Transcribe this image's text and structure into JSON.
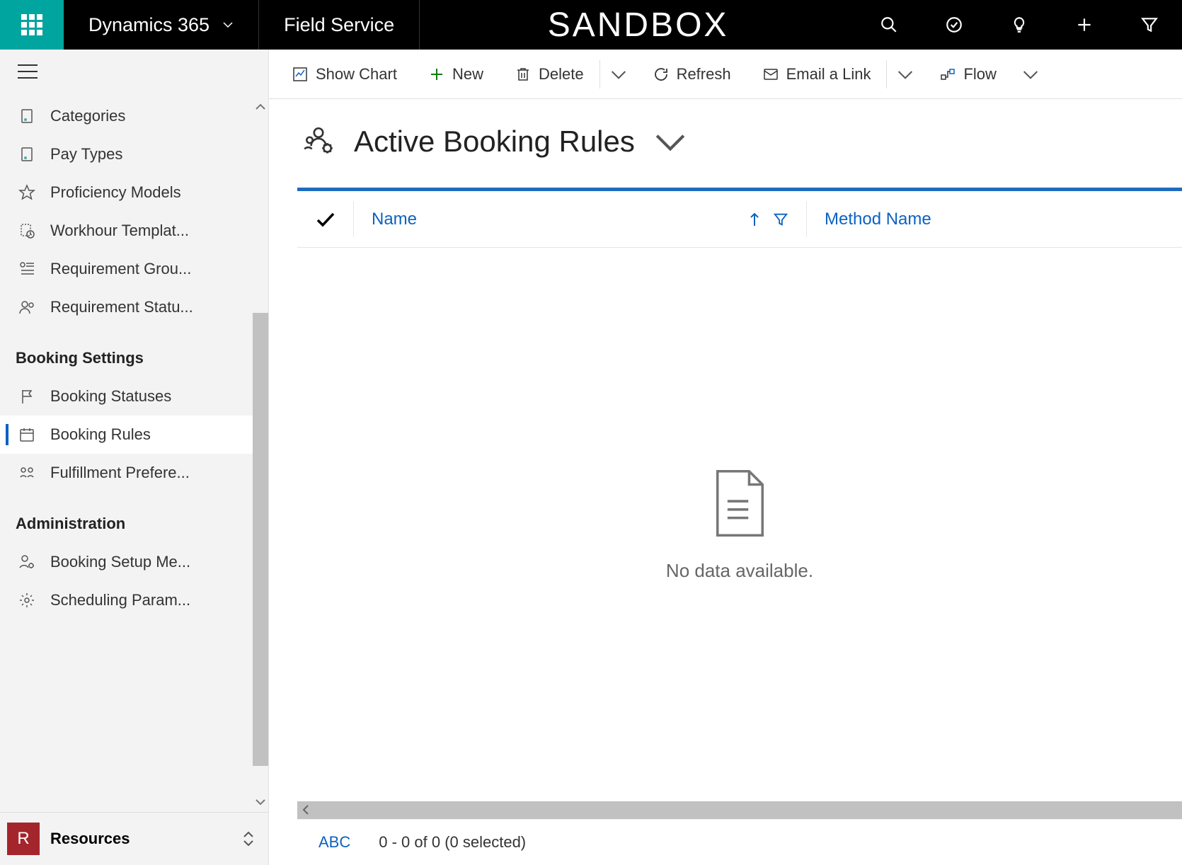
{
  "topbar": {
    "app_name": "Dynamics 365",
    "module": "Field Service",
    "environment": "SANDBOX"
  },
  "commandbar": {
    "show_chart": "Show Chart",
    "new": "New",
    "delete": "Delete",
    "refresh": "Refresh",
    "email_link": "Email a Link",
    "flow": "Flow"
  },
  "sidebar": {
    "items_top": [
      {
        "label": "Categories"
      },
      {
        "label": "Pay Types"
      },
      {
        "label": "Proficiency Models"
      },
      {
        "label": "Workhour Templat..."
      },
      {
        "label": "Requirement Grou..."
      },
      {
        "label": "Requirement Statu..."
      }
    ],
    "section_booking": "Booking Settings",
    "items_booking": [
      {
        "label": "Booking Statuses"
      },
      {
        "label": "Booking Rules",
        "active": true
      },
      {
        "label": "Fulfillment Prefere..."
      }
    ],
    "section_admin": "Administration",
    "items_admin": [
      {
        "label": "Booking Setup Me..."
      },
      {
        "label": "Scheduling Param..."
      }
    ],
    "area_badge": "R",
    "area_label": "Resources"
  },
  "view": {
    "title": "Active Booking Rules",
    "columns": {
      "name": "Name",
      "method": "Method Name"
    },
    "empty_text": "No data available.",
    "footer_abc": "ABC",
    "footer_count": "0 - 0 of 0 (0 selected)"
  }
}
